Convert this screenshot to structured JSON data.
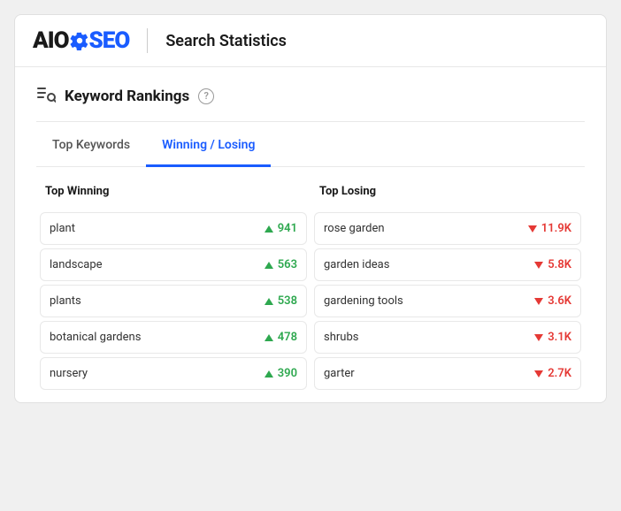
{
  "header": {
    "logo_aio": "AIO",
    "logo_seo": "SEO",
    "page_title": "Search Statistics"
  },
  "section": {
    "title": "Keyword Rankings",
    "help_label": "?"
  },
  "tabs": [
    {
      "id": "top-keywords",
      "label": "Top Keywords",
      "active": false
    },
    {
      "id": "winning-losing",
      "label": "Winning / Losing",
      "active": true
    }
  ],
  "winning": {
    "header": "Top Winning",
    "rows": [
      {
        "keyword": "plant",
        "value": "941"
      },
      {
        "keyword": "landscape",
        "value": "563"
      },
      {
        "keyword": "plants",
        "value": "538"
      },
      {
        "keyword": "botanical gardens",
        "value": "478"
      },
      {
        "keyword": "nursery",
        "value": "390"
      }
    ]
  },
  "losing": {
    "header": "Top Losing",
    "rows": [
      {
        "keyword": "rose garden",
        "value": "11.9K"
      },
      {
        "keyword": "garden ideas",
        "value": "5.8K"
      },
      {
        "keyword": "gardening tools",
        "value": "3.6K"
      },
      {
        "keyword": "shrubs",
        "value": "3.1K"
      },
      {
        "keyword": "garter",
        "value": "2.7K"
      }
    ]
  }
}
